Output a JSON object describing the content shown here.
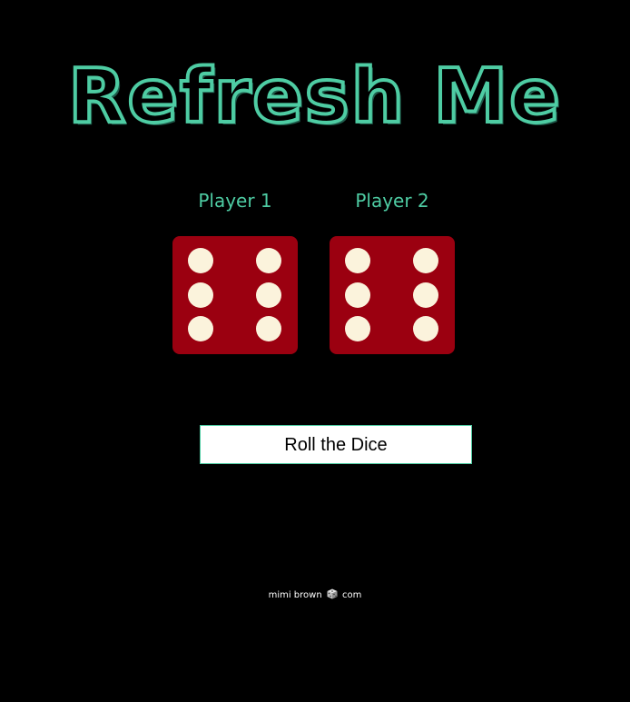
{
  "header": {
    "title": "Refresh Me"
  },
  "players": [
    {
      "label": "Player 1",
      "die_value": 6,
      "die_icon": "dice-six-icon"
    },
    {
      "label": "Player 2",
      "die_value": 6,
      "die_icon": "dice-six-icon"
    }
  ],
  "controls": {
    "roll_label": "Roll the Dice"
  },
  "footer": {
    "prefix": "mimi brown",
    "icon": "dice-icon",
    "suffix": "com"
  },
  "colors": {
    "background": "#000000",
    "accent": "#4ecca3",
    "die_face": "#9b0010",
    "pip": "#fbf3dc",
    "button_background": "#ffffff"
  }
}
